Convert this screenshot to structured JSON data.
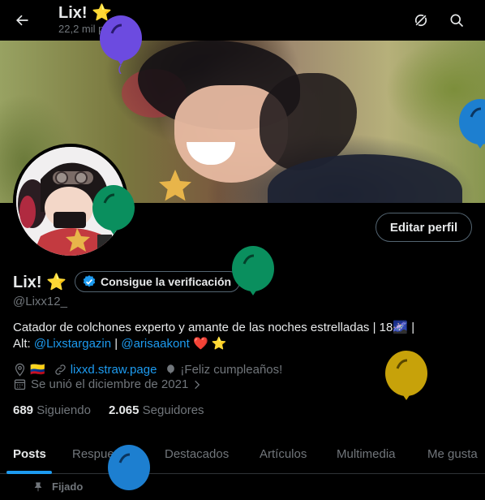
{
  "header": {
    "title": "Lix! ⭐",
    "subtitle": "22,2 mil posts"
  },
  "profile": {
    "name": "Lix! ⭐",
    "verification_label": "Consigue la verificación",
    "handle": "@Lixx12_",
    "edit_button": "Editar perfil",
    "bio_line1": "Catador de colchones experto y amante de las noches estrelladas | 18🌌 |",
    "bio_alt_prefix": "Alt: ",
    "bio_alt_link1": "@Lixstargazin",
    "bio_alt_sep": " | ",
    "bio_alt_link2": "@arisaakont",
    "bio_alt_suffix": " ❤️ ⭐",
    "location_flag": "🇨🇴",
    "website": "lixxd.straw.page",
    "birthday": "¡Feliz cumpleaños!",
    "joined": "Se unió el diciembre de 2021",
    "following_count": "689",
    "following_label": "Siguiendo",
    "followers_count": "2.065",
    "followers_label": "Seguidores"
  },
  "tabs": [
    "Posts",
    "Respuestas",
    "Destacados",
    "Artículos",
    "Multimedia",
    "Me gusta"
  ],
  "pinned_label": "Fijado",
  "colors": {
    "accent": "#1d9bf0",
    "balloon_purple": "#6c4be0",
    "balloon_green": "#0a8f5e",
    "balloon_blue": "#1d7fd0",
    "balloon_gold": "#c7a20a"
  }
}
